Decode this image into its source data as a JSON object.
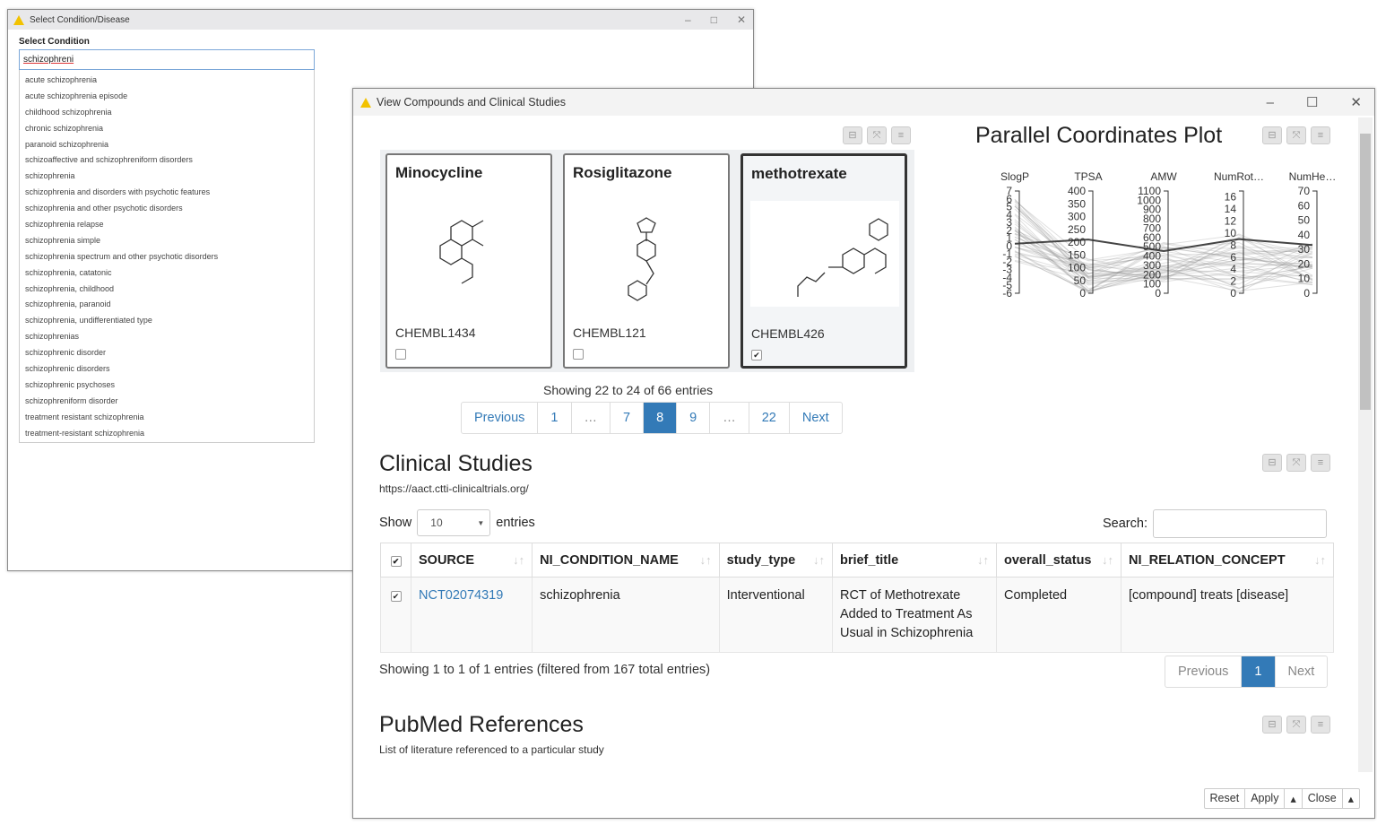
{
  "window1": {
    "title": "Select Condition/Disease",
    "label": "Select Condition",
    "input_value": "schizophreni",
    "options": [
      "acute schizophrenia",
      "acute schizophrenia episode",
      "childhood schizophrenia",
      "chronic schizophrenia",
      "paranoid schizophrenia",
      "schizoaffective and schizophreniform disorders",
      "schizophrenia",
      "schizophrenia and disorders with psychotic features",
      "schizophrenia and other psychotic disorders",
      "schizophrenia relapse",
      "schizophrenia simple",
      "schizophrenia spectrum and other psychotic disorders",
      "schizophrenia, catatonic",
      "schizophrenia, childhood",
      "schizophrenia, paranoid",
      "schizophrenia, undifferentiated type",
      "schizophrenias",
      "schizophrenic disorder",
      "schizophrenic disorders",
      "schizophrenic psychoses",
      "schizophreniform disorder",
      "treatment resistant schizophrenia",
      "treatment-resistant schizophrenia"
    ]
  },
  "window2": {
    "title": "View Compounds and Clinical Studies",
    "compounds": [
      {
        "name": "Minocycline",
        "id": "CHEMBL1434",
        "checked": false
      },
      {
        "name": "Rosiglitazone",
        "id": "CHEMBL121",
        "checked": false
      },
      {
        "name": "methotrexate",
        "id": "CHEMBL426",
        "checked": true
      }
    ],
    "compounds_info": "Showing 22 to 24 of 66 entries",
    "compounds_pager": [
      "Previous",
      "1",
      "…",
      "7",
      "8",
      "9",
      "…",
      "22",
      "Next"
    ],
    "compounds_pager_active": "8",
    "pcp_title": "Parallel Coordinates Plot",
    "clinical": {
      "title": "Clinical Studies",
      "url": "https://aact.ctti-clinicaltrials.org/",
      "show": "Show",
      "length": "10",
      "entries": "entries",
      "search_label": "Search:",
      "search_value": "",
      "columns": [
        "SOURCE",
        "NI_CONDITION_NAME",
        "study_type",
        "brief_title",
        "overall_status",
        "NI_RELATION_CONCEPT"
      ],
      "rows": [
        {
          "checked": true,
          "source": "NCT02074319",
          "condition": "schizophrenia",
          "study_type": "Interventional",
          "brief_title": "RCT of Methotrexate Added to Treatment As Usual in Schizophrenia",
          "status": "Completed",
          "relation": "[compound] treats [disease]"
        }
      ],
      "info": "Showing 1 to 1 of 1 entries (filtered from 167 total entries)",
      "pager": [
        "Previous",
        "1",
        "Next"
      ]
    },
    "pubmed": {
      "title": "PubMed References",
      "subtitle": "List of literature referenced to a particular study"
    },
    "buttons": [
      "Reset",
      "Apply",
      "▴",
      "Close",
      "▴"
    ]
  },
  "chart_data": {
    "type": "parallel-coordinates",
    "title": "Parallel Coordinates Plot",
    "axes": [
      {
        "name": "SlogP",
        "range": [
          -6,
          7
        ]
      },
      {
        "name": "TPSA",
        "range": [
          0,
          400
        ],
        "ticks": [
          0,
          50,
          100,
          150,
          200,
          250,
          300,
          350,
          400
        ]
      },
      {
        "name": "AMW",
        "range": [
          0,
          1100
        ],
        "ticks": [
          0,
          100,
          200,
          300,
          400,
          500,
          600,
          700,
          800,
          900,
          1000,
          1100
        ]
      },
      {
        "name": "NumRot…",
        "range": [
          0,
          17
        ],
        "ticks": [
          0,
          2,
          4,
          6,
          8,
          10,
          12,
          14,
          16
        ]
      },
      {
        "name": "NumHe…",
        "range": [
          0,
          70
        ],
        "ticks": [
          0,
          10,
          20,
          30,
          40,
          50,
          60,
          70
        ]
      }
    ],
    "highlighted": [
      0.3,
      210,
      454,
      9,
      33
    ]
  }
}
